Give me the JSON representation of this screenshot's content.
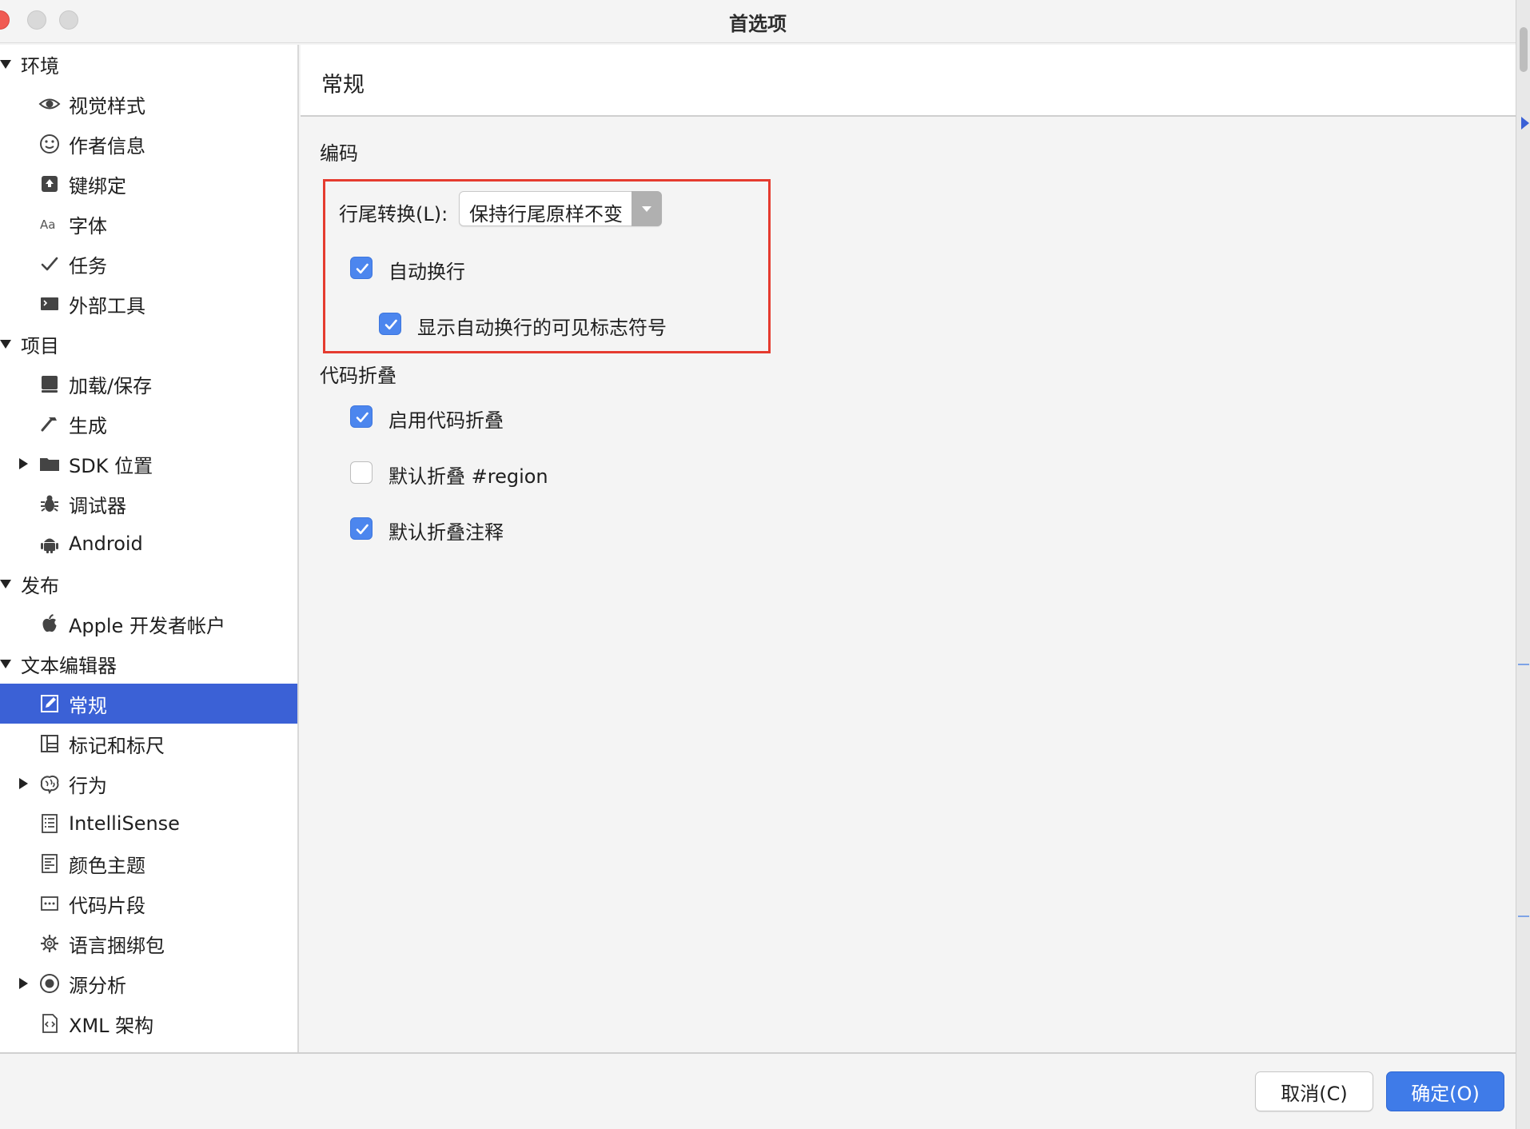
{
  "window": {
    "title": "首选项"
  },
  "sidebar": {
    "rows": [
      {
        "kind": "category",
        "label": "环境",
        "expand": "down"
      },
      {
        "kind": "item",
        "label": "视觉样式",
        "icon": "eye-icon"
      },
      {
        "kind": "item",
        "label": "作者信息",
        "icon": "smiley-icon"
      },
      {
        "kind": "item",
        "label": "键绑定",
        "icon": "keyboard-key-icon"
      },
      {
        "kind": "item",
        "label": "字体",
        "icon": "font-aa-icon"
      },
      {
        "kind": "item",
        "label": "任务",
        "icon": "checkmark-icon"
      },
      {
        "kind": "item",
        "label": "外部工具",
        "icon": "terminal-icon"
      },
      {
        "kind": "category",
        "label": "项目",
        "expand": "down"
      },
      {
        "kind": "item",
        "label": "加载/保存",
        "icon": "disk-icon"
      },
      {
        "kind": "item",
        "label": "生成",
        "icon": "hammer-icon"
      },
      {
        "kind": "item",
        "label": "SDK 位置",
        "icon": "folder-icon",
        "expand": "right"
      },
      {
        "kind": "item",
        "label": "调试器",
        "icon": "bug-icon"
      },
      {
        "kind": "item",
        "label": "Android",
        "icon": "android-icon"
      },
      {
        "kind": "category",
        "label": "发布",
        "expand": "down"
      },
      {
        "kind": "item",
        "label": "Apple 开发者帐户",
        "icon": "apple-icon"
      },
      {
        "kind": "category",
        "label": "文本编辑器",
        "expand": "down"
      },
      {
        "kind": "item",
        "label": "常规",
        "icon": "edit-icon",
        "selected": true
      },
      {
        "kind": "item",
        "label": "标记和标尺",
        "icon": "ruler-grid-icon"
      },
      {
        "kind": "item",
        "label": "行为",
        "icon": "brain-icon",
        "expand": "right"
      },
      {
        "kind": "item",
        "label": "IntelliSense",
        "icon": "list-doc-icon"
      },
      {
        "kind": "item",
        "label": "颜色主题",
        "icon": "theme-doc-icon"
      },
      {
        "kind": "item",
        "label": "代码片段",
        "icon": "snippet-icon"
      },
      {
        "kind": "item",
        "label": "语言捆绑包",
        "icon": "gear-icon"
      },
      {
        "kind": "item",
        "label": "源分析",
        "icon": "target-icon",
        "expand": "right"
      },
      {
        "kind": "item",
        "label": "XML 架构",
        "icon": "xml-icon"
      }
    ]
  },
  "main": {
    "title": "常规",
    "encoding": {
      "section_label": "编码",
      "line_ending_label": "行尾转换(L):",
      "line_ending_value": "保持行尾原样不变",
      "word_wrap": {
        "label": "自动换行",
        "checked": true
      },
      "show_wrap_markers": {
        "label": "显示自动换行的可见标志符号",
        "checked": true
      }
    },
    "folding": {
      "section_label": "代码折叠",
      "enable": {
        "label": "启用代码折叠",
        "checked": true
      },
      "region": {
        "label": "默认折叠 #region",
        "checked": false
      },
      "comments": {
        "label": "默认折叠注释",
        "checked": true
      }
    }
  },
  "footer": {
    "cancel_label": "取消(C)",
    "ok_label": "确定(O)"
  },
  "colors": {
    "selection": "#3b61d6",
    "checkbox": "#4c86ee",
    "highlight_box": "#e53b2f",
    "primary_button": "#3f7be8"
  }
}
